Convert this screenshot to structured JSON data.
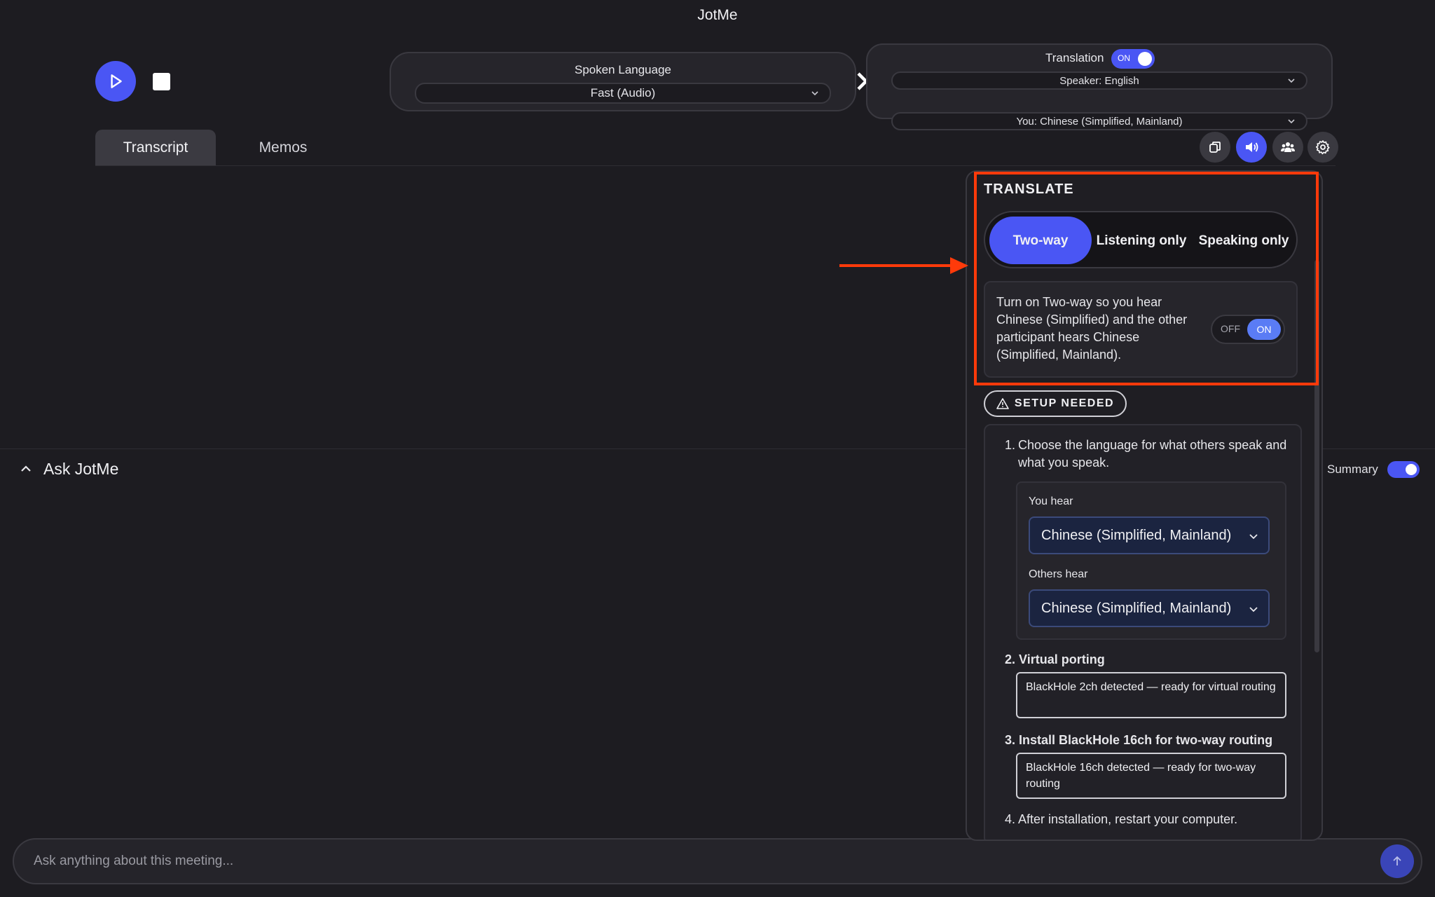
{
  "app": {
    "title": "JotMe"
  },
  "colors": {
    "accent": "#4a56f4",
    "highlight": "#ff3a0a",
    "background": "#1d1c21"
  },
  "controls": {
    "play_icon": "play-icon",
    "stop_icon": "stop-icon"
  },
  "spoken": {
    "label": "Spoken Language",
    "value": "Fast (Audio)"
  },
  "translation": {
    "label": "Translation",
    "toggle_state": "ON",
    "speaker": "Speaker: English",
    "you": "You: Chinese (Simplified, Mainland)"
  },
  "tabs": [
    {
      "label": "Transcript",
      "active": true
    },
    {
      "label": "Memos",
      "active": false
    }
  ],
  "toolbar": {
    "icons": [
      "copy-icon",
      "speaker-icon",
      "people-icon",
      "gear-icon"
    ]
  },
  "popup": {
    "heading": "TRANSLATE",
    "modes": [
      {
        "label": "Two-way",
        "active": true
      },
      {
        "label": "Listening only",
        "active": false
      },
      {
        "label": "Speaking only",
        "active": false
      }
    ],
    "twoway_text": "Turn on Two-way so you hear Chinese (Simplified) and the other participant hears Chinese (Simplified, Mainland).",
    "twoway_toggle": {
      "off": "OFF",
      "on": "ON"
    },
    "setup_badge": "SETUP NEEDED",
    "steps": {
      "step1": "Choose the language for what others speak and what you speak.",
      "you_hear_label": "You hear",
      "you_hear_value": "Chinese (Simplified, Mainland)",
      "others_hear_label": "Others hear",
      "others_hear_value": "Chinese (Simplified, Mainland)",
      "step2": "Virtual porting",
      "step2_status": "BlackHole 2ch detected — ready for virtual routing",
      "step3": "Install BlackHole 16ch for two-way routing",
      "step3_status": "BlackHole 16ch detected — ready for two-way routing",
      "step4": "After installation, restart your computer."
    }
  },
  "ask": {
    "title": "Ask JotMe",
    "summary_label": "Summary",
    "summary_on": true,
    "placeholder": "Ask anything about this meeting..."
  }
}
